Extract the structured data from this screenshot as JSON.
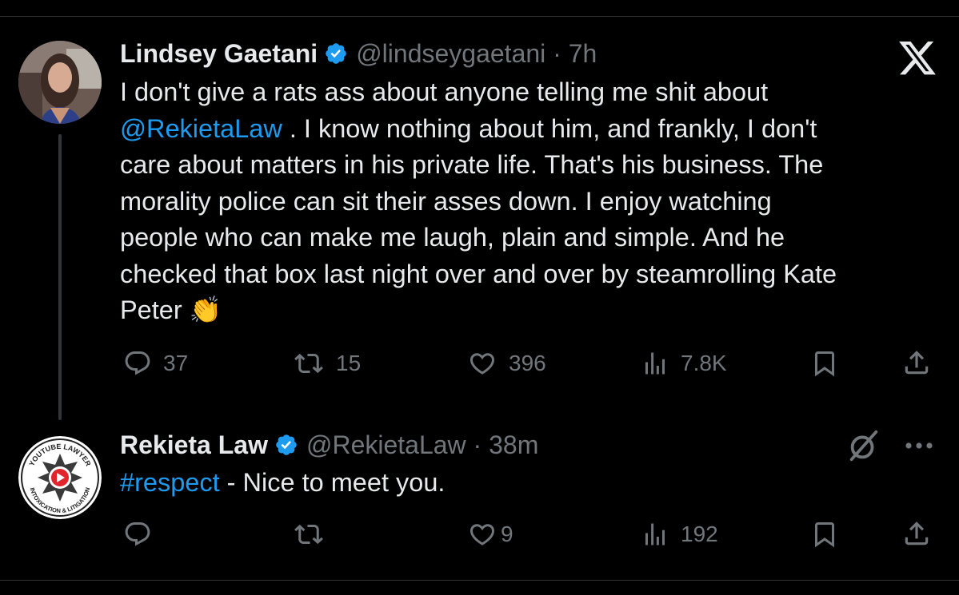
{
  "tweet1": {
    "name": "Lindsey Gaetani",
    "handle": "@lindseygaetani",
    "separator": " · ",
    "time": "7h",
    "lines": [
      [
        "I don't give a rats ass about anyone telling me shit about"
      ],
      [
        "@RekietaLaw",
        " . I know nothing about him, and frankly, I don't"
      ],
      [
        "care about matters in his private life. That's his business. The"
      ],
      [
        "morality police can sit their asses down. I enjoy watching"
      ],
      [
        "people who can make me laugh, plain and simple. And he"
      ],
      [
        "checked that box last night over and over by steamrolling Kate"
      ],
      [
        "Peter ",
        "👏"
      ]
    ],
    "replies": "37",
    "reposts": "15",
    "likes": "396",
    "views": "7.8K"
  },
  "tweet2": {
    "name": "Rekieta Law",
    "handle": "@RekietaLaw",
    "separator": " · ",
    "time": "38m",
    "hashtag": "#respect",
    "text_rest": " - Nice to meet you.",
    "replies": "",
    "reposts": "",
    "likes": "9",
    "views": "192"
  },
  "avatar2": {
    "top_text": "YOUTUBE LAWYER",
    "bottom_text": "INTOXICATION & LITIGATION"
  },
  "colors": {
    "background": "#000000",
    "text": "#e7e9ea",
    "muted": "#71767b",
    "accent": "#1d9bf0"
  },
  "icons": [
    "verified-badge-icon",
    "x-logo-icon",
    "reply-icon",
    "repost-icon",
    "like-icon",
    "views-icon",
    "bookmark-icon",
    "share-icon",
    "grok-icon",
    "more-icon"
  ]
}
